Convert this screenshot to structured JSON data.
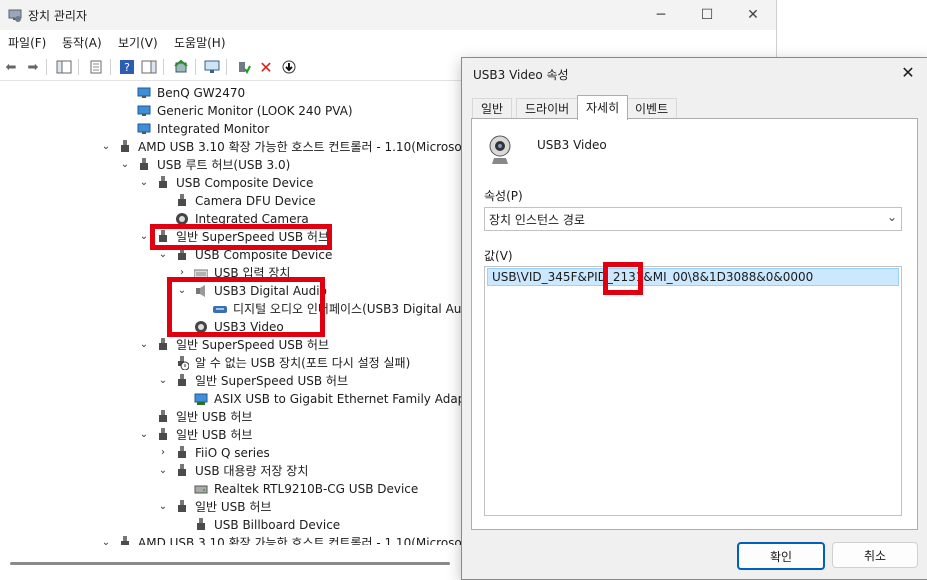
{
  "main": {
    "title": "장치 관리자",
    "menu": [
      "파일(F)",
      "동작(A)",
      "보기(V)",
      "도움말(H)"
    ],
    "tree": [
      {
        "label": "BenQ GW2470"
      },
      {
        "label": "Generic Monitor (LOOK 240 PVA)"
      },
      {
        "label": "Integrated Monitor"
      },
      {
        "label": "AMD USB 3.10 확장 가능한 호스트 컨트롤러 - 1.10(Microso"
      },
      {
        "label": "USB 루트 허브(USB 3.0)"
      },
      {
        "label": "USB Composite Device"
      },
      {
        "label": "Camera DFU Device"
      },
      {
        "label": "Integrated Camera"
      },
      {
        "label": "일반 SuperSpeed USB 허브"
      },
      {
        "label": "USB Composite Device"
      },
      {
        "label": "USB 입력 장치"
      },
      {
        "label": "USB3 Digital Audio"
      },
      {
        "label": "디지털 오디오 인터페이스(USB3 Digital Au"
      },
      {
        "label": "USB3 Video"
      },
      {
        "label": "일반 SuperSpeed USB 허브"
      },
      {
        "label": "알 수 없는 USB 장치(포트 다시 설정 실패)"
      },
      {
        "label": "일반 SuperSpeed USB 허브"
      },
      {
        "label": "ASIX USB to Gigabit Ethernet Family Adapter"
      },
      {
        "label": "일반 USB 허브"
      },
      {
        "label": "일반 USB 허브"
      },
      {
        "label": "FiiO Q series"
      },
      {
        "label": "USB 대용량 저장 장치"
      },
      {
        "label": "Realtek RTL9210B-CG USB Device"
      },
      {
        "label": "일반 USB 허브"
      },
      {
        "label": "USB Billboard Device"
      },
      {
        "label": "AMD USB 3.10 확장 가능한 호스트 컨트롤러 - 1.10(Microso"
      }
    ]
  },
  "dialog": {
    "title": "USB3 Video 속성",
    "tabs": [
      "일반",
      "드라이버",
      "자세히",
      "이벤트"
    ],
    "device_name": "USB3 Video",
    "property_label": "속성(P)",
    "property_value": "장치 인스턴스 경로",
    "value_label": "값(V)",
    "value_prefix": "USB\\VID_345F&PID_",
    "value_pid": "2131",
    "value_suffix": "&MI_00\\8&1D3088&0&0000",
    "ok_label": "확인",
    "cancel_label": "취소"
  },
  "colors": {
    "highlight": "#e0000f",
    "selection": "#cce8ff",
    "accent": "#005fb8"
  }
}
